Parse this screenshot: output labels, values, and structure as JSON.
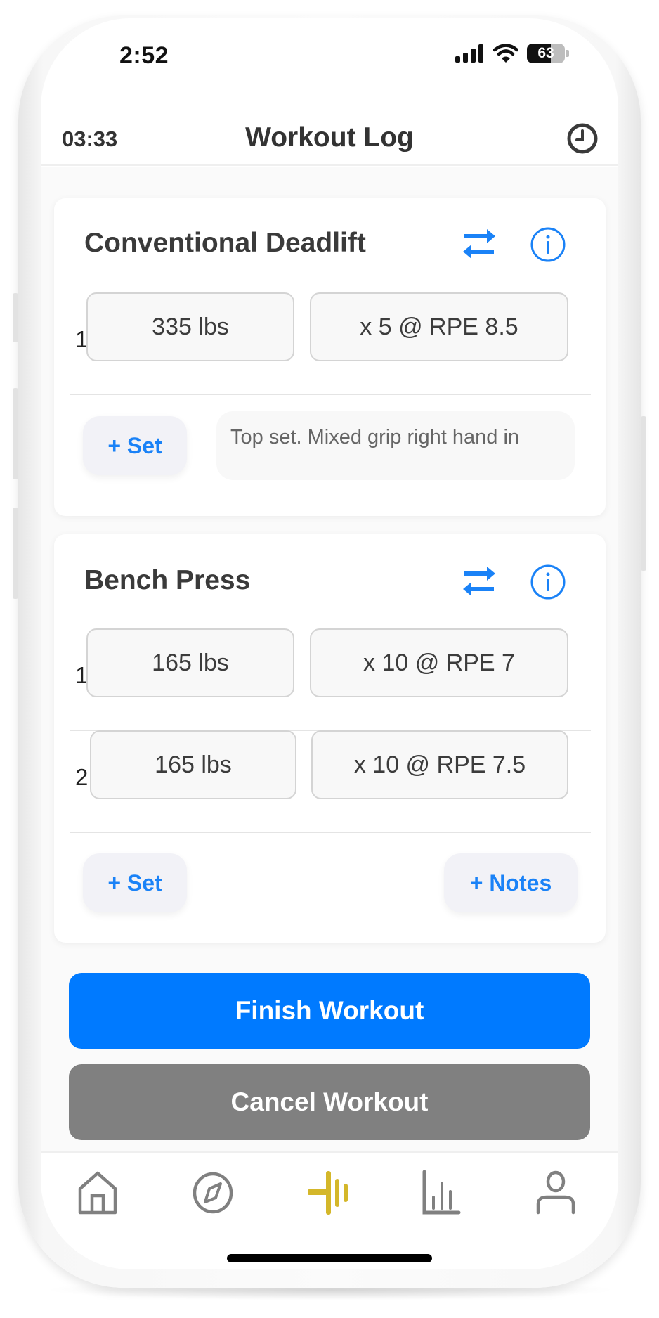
{
  "status_bar": {
    "time": "2:52",
    "battery_percent": 63,
    "battery_label": "63",
    "icons": [
      "cellular-signal-icon",
      "wifi-icon",
      "battery-icon"
    ]
  },
  "header": {
    "elapsed_time": "03:33",
    "title": "Workout Log",
    "history_icon": "clock-icon"
  },
  "exercises": [
    {
      "name": "Conventional Deadlift",
      "swap_icon": "swap-arrows-icon",
      "info_icon": "info-icon",
      "sets": [
        {
          "number": "1",
          "weight": "335 lbs",
          "reps_rpe": "x 5 @ RPE 8.5"
        }
      ],
      "add_set_label": "+ Set",
      "notes": "Top set. Mixed grip right hand in"
    },
    {
      "name": "Bench Press",
      "swap_icon": "swap-arrows-icon",
      "info_icon": "info-icon",
      "sets": [
        {
          "number": "1",
          "weight": "165 lbs",
          "reps_rpe": "x 10 @ RPE 7"
        },
        {
          "number": "2",
          "weight": "165 lbs",
          "reps_rpe": "x 10 @ RPE 7.5"
        }
      ],
      "add_set_label": "+ Set",
      "add_notes_label": "+ Notes"
    }
  ],
  "actions": {
    "finish_label": "Finish Workout",
    "cancel_label": "Cancel Workout"
  },
  "tab_bar": {
    "items": [
      {
        "name": "home",
        "icon": "home-icon",
        "active": false
      },
      {
        "name": "explore",
        "icon": "compass-icon",
        "active": false
      },
      {
        "name": "workout",
        "icon": "barbell-icon",
        "active": true
      },
      {
        "name": "stats",
        "icon": "bar-chart-icon",
        "active": false
      },
      {
        "name": "profile",
        "icon": "person-icon",
        "active": false
      }
    ]
  },
  "colors": {
    "accent_blue": "#1a82f7",
    "finish_button": "#007aff",
    "cancel_button": "#808080",
    "active_tab": "#d4b72a",
    "inactive_tab": "#808080",
    "text_dark": "#333333"
  }
}
